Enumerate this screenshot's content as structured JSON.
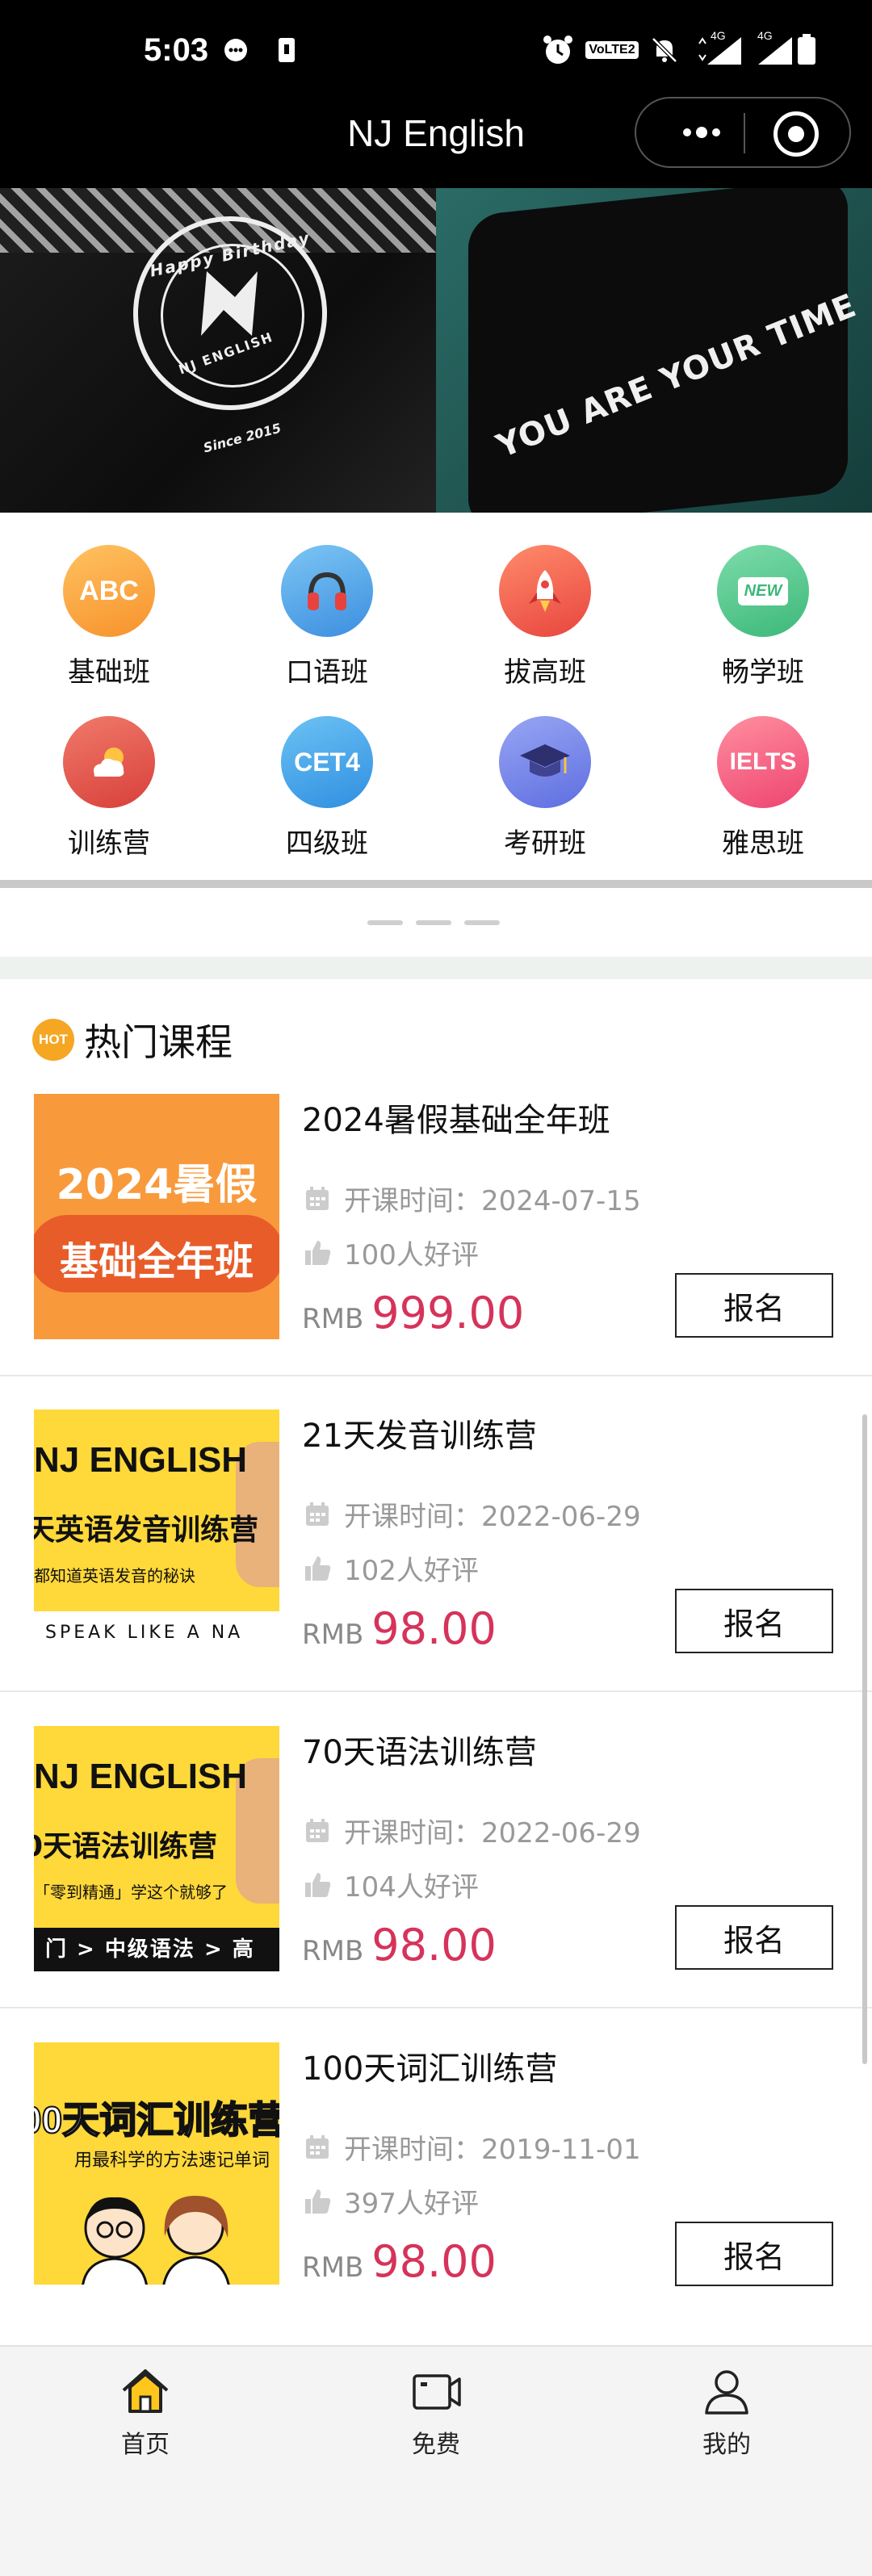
{
  "status_bar": {
    "time": "5:03",
    "network_1": "4G",
    "network_2": "4G",
    "volte": "VoLTE2"
  },
  "navbar": {
    "title": "NJ English"
  },
  "banner": {
    "slides": [
      {
        "lines": [
          "Happy Birthday",
          "NJ ENGLISH",
          "Since 2015"
        ]
      },
      {
        "lines": [
          "YOU ARE YOUR TIME"
        ]
      }
    ]
  },
  "categories": [
    {
      "label": "基础班",
      "icon": "abc-icon",
      "glyph": "ABC",
      "color": "#f7a03c"
    },
    {
      "label": "口语班",
      "icon": "headphones-icon",
      "glyph": "",
      "color": "#4aa3e8"
    },
    {
      "label": "拔高班",
      "icon": "rocket-icon",
      "glyph": "",
      "color": "#f0604a"
    },
    {
      "label": "畅学班",
      "icon": "new-badge-icon",
      "glyph": "NEW",
      "color": "#4cc28a"
    },
    {
      "label": "训练营",
      "icon": "weather-icon",
      "glyph": "",
      "color": "#e2524b"
    },
    {
      "label": "四级班",
      "icon": "cet4-icon",
      "glyph": "CET4",
      "color": "#3aa0e8"
    },
    {
      "label": "考研班",
      "icon": "graduation-cap-icon",
      "glyph": "",
      "color": "#6c7de8"
    },
    {
      "label": "雅思班",
      "icon": "ielts-icon",
      "glyph": "IELTS",
      "color": "#f0557a"
    }
  ],
  "hot": {
    "badge": "HOT",
    "title": "热门课程"
  },
  "courses": [
    {
      "title": "2024暑假基础全年班",
      "start": "开课时间：2024-07-15",
      "reviews": "100人好评",
      "currency": "RMB",
      "price": "999.00",
      "button": "报名",
      "thumb": {
        "line1": "2024暑假",
        "line2": "基础全年班"
      }
    },
    {
      "title": "21天发音训练营",
      "start": "开课时间：2022-06-29",
      "reviews": "102人好评",
      "currency": "RMB",
      "price": "98.00",
      "button": "报名",
      "thumb": {
        "line1": "NJ ENGLISH",
        "line2": "天英语发音训练营",
        "line3": "都知道英语发音的秘诀",
        "line4": "SPEAK LIKE A NA"
      }
    },
    {
      "title": "70天语法训练营",
      "start": "开课时间：2022-06-29",
      "reviews": "104人好评",
      "currency": "RMB",
      "price": "98.00",
      "button": "报名",
      "thumb": {
        "line1": "NJ ENGLISH",
        "line2": "0天语法训练营",
        "line3": "「零到精通」学这个就够了",
        "line4": "门 > 中级语法 > 高"
      }
    },
    {
      "title": "100天词汇训练营",
      "start": "开课时间：2019-11-01",
      "reviews": "397人好评",
      "currency": "RMB",
      "price": "98.00",
      "button": "报名",
      "thumb": {
        "line1": "00天词汇训练营",
        "line2": "用最科学的方法速记单词"
      }
    }
  ],
  "tabbar": [
    {
      "label": "首页",
      "icon": "home-icon",
      "active": true
    },
    {
      "label": "免费",
      "icon": "video-icon",
      "active": false
    },
    {
      "label": "我的",
      "icon": "user-icon",
      "active": false
    }
  ]
}
